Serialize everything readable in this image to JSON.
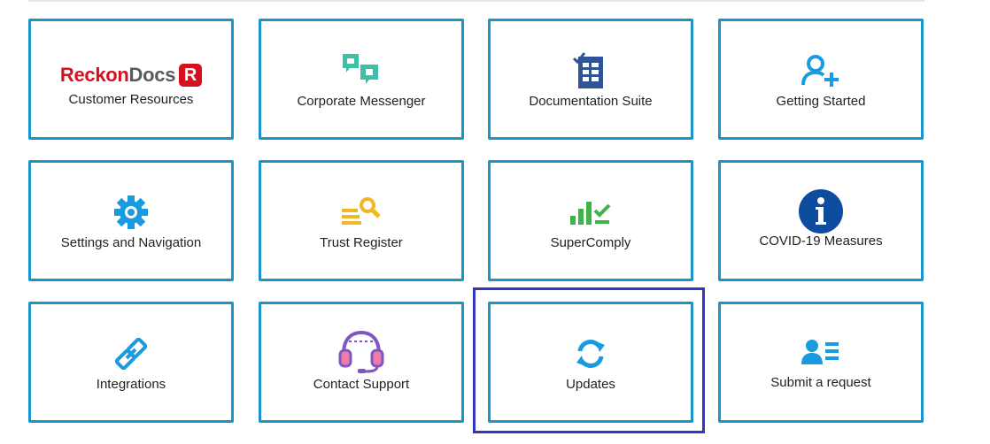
{
  "brand": {
    "part1": "Reckon",
    "part2": "Docs",
    "badge": "R"
  },
  "tiles": [
    {
      "label": "Customer Resources",
      "icon": "reckondocs-logo"
    },
    {
      "label": "Corporate Messenger",
      "icon": "chat-bubbles-icon"
    },
    {
      "label": "Documentation Suite",
      "icon": "document-check-icon"
    },
    {
      "label": "Getting Started",
      "icon": "add-user-icon"
    },
    {
      "label": "Settings and Navigation",
      "icon": "gear-icon"
    },
    {
      "label": "Trust Register",
      "icon": "search-list-icon"
    },
    {
      "label": "SuperComply",
      "icon": "chart-check-icon"
    },
    {
      "label": "COVID-19 Measures",
      "icon": "info-icon"
    },
    {
      "label": "Integrations",
      "icon": "link-icon"
    },
    {
      "label": "Contact Support",
      "icon": "headset-icon"
    },
    {
      "label": "Updates",
      "icon": "refresh-icon"
    },
    {
      "label": "Submit a request",
      "icon": "user-list-icon"
    }
  ],
  "selected_tile": "Updates",
  "colors": {
    "tile_border": "#1a95c9",
    "highlight_border": "#3236c2",
    "brand_red": "#d5111f",
    "icon_blue": "#1a9be0",
    "icon_teal": "#3cc0a8",
    "icon_green": "#3cb44a",
    "icon_yellow": "#f2b824",
    "icon_purple": "#7e57c2"
  }
}
